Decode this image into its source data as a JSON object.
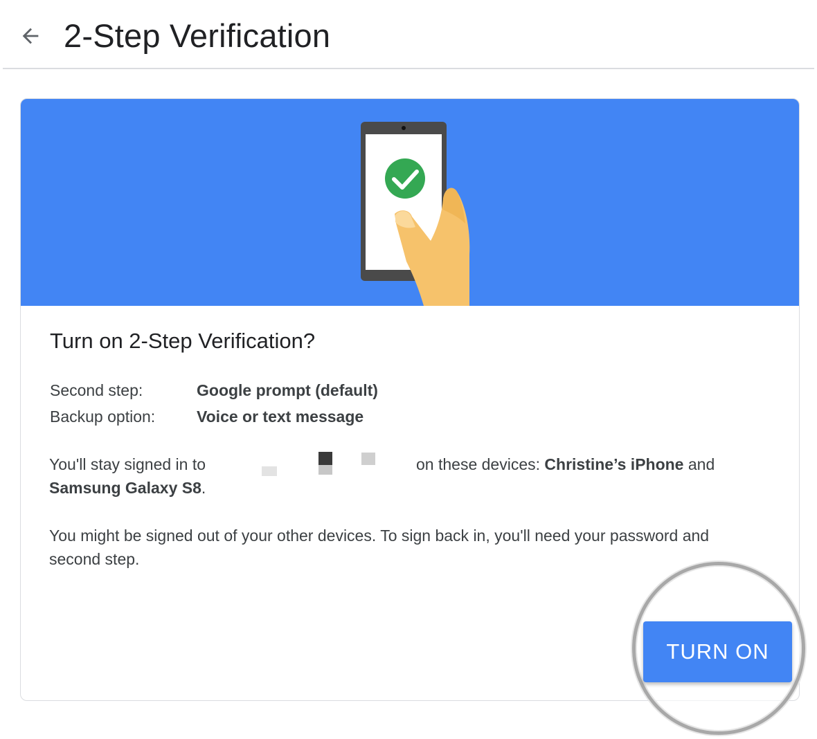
{
  "header": {
    "back_icon": "arrow-left-icon",
    "title": "2-Step Verification"
  },
  "hero": {
    "illustration": "phone-with-checkmark-in-hand",
    "colors": {
      "background": "#4285f4",
      "check": "#34a853"
    }
  },
  "dialog": {
    "title": "Turn on 2-Step Verification?",
    "rows": [
      {
        "label": "Second step:",
        "value": "Google prompt (default)"
      },
      {
        "label": "Backup option:",
        "value": "Voice or text message"
      }
    ],
    "signed_in": {
      "prefix": "You'll stay signed in to",
      "suffix": "on these devices:",
      "device1": "Christine’s iPhone",
      "conjunction": "and",
      "device2": "Samsung Galaxy S8",
      "end": "."
    },
    "warning_line1": "You might be signed out of your other devices. To sign back in, you'll need your password and",
    "warning_line2": "second step."
  },
  "actions": {
    "turn_on_label": "TURN ON",
    "accent_color": "#4285f4"
  }
}
